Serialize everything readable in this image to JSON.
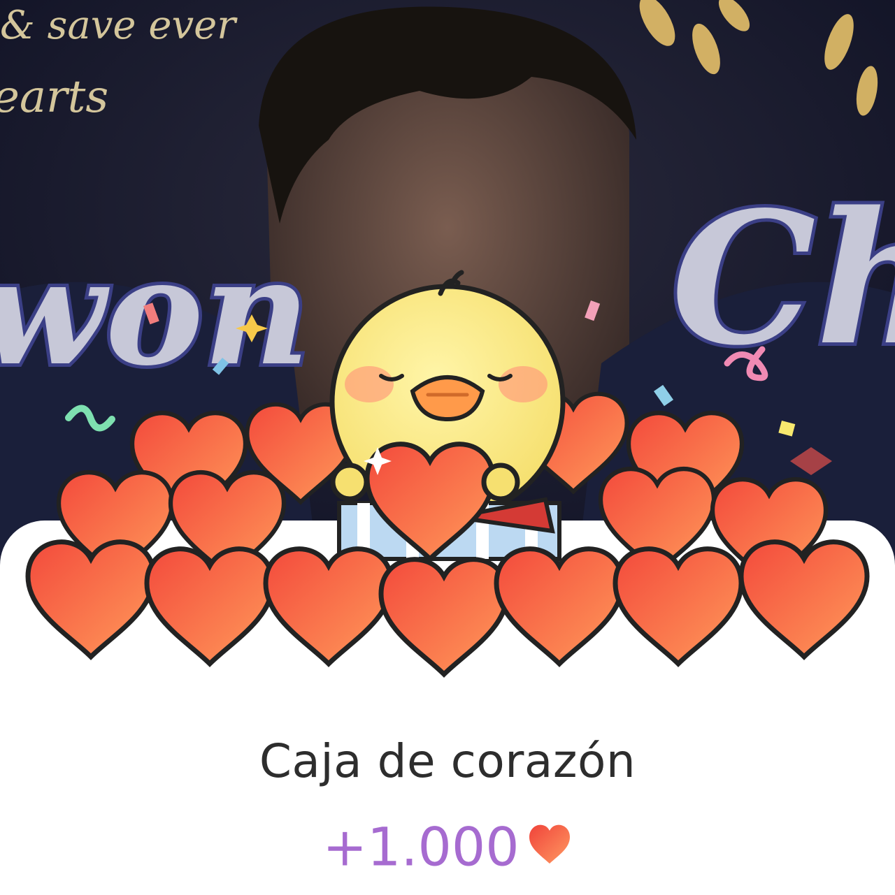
{
  "background": {
    "caption_text": "& save ever\nearts",
    "overlay_name_left": "won",
    "overlay_name_right": "Cho"
  },
  "gift": {
    "name": "Caja de corazón",
    "amount": "+1.000",
    "icon": "heart-icon",
    "amount_color": "#a66bd0",
    "heart_color": "#f5584a"
  }
}
